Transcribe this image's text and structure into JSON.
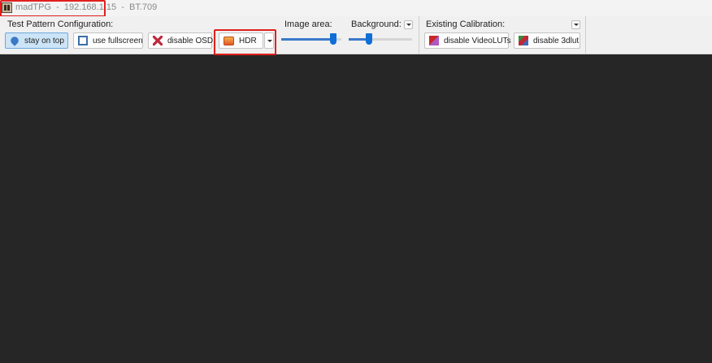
{
  "titlebar": {
    "app_name": "madTPG",
    "separator": "  -  ",
    "ip_address": "192.168.1.15",
    "separator2": "  -  ",
    "colorspace": "BT.709",
    "app_icon": "madtpg-icon"
  },
  "toolbar": {
    "test_pattern": {
      "label": "Test Pattern Configuration:",
      "buttons": [
        {
          "label": "stay on top",
          "icon": "pin-icon",
          "active": true
        },
        {
          "label": "use fullscreen",
          "icon": "fullscreen-icon",
          "active": false
        },
        {
          "label": "disable OSD",
          "icon": "osd-off-icon",
          "active": false
        },
        {
          "label": "HDR",
          "icon": "hdr-icon",
          "active": false
        }
      ]
    },
    "image_area": {
      "label": "Image area:",
      "value": 1.0
    },
    "background": {
      "label": "Background:",
      "value": 0.33
    },
    "existing_calibration": {
      "label": "Existing Calibration:",
      "buttons": [
        {
          "label": "disable VideoLUTs",
          "icon": "videoluts-icon"
        },
        {
          "label": "disable 3dlut",
          "icon": "3dlut-icon"
        }
      ]
    }
  },
  "colors": {
    "highlight": "#e0201c",
    "accent": "#0f6fd6",
    "content_bg": "#262626"
  }
}
